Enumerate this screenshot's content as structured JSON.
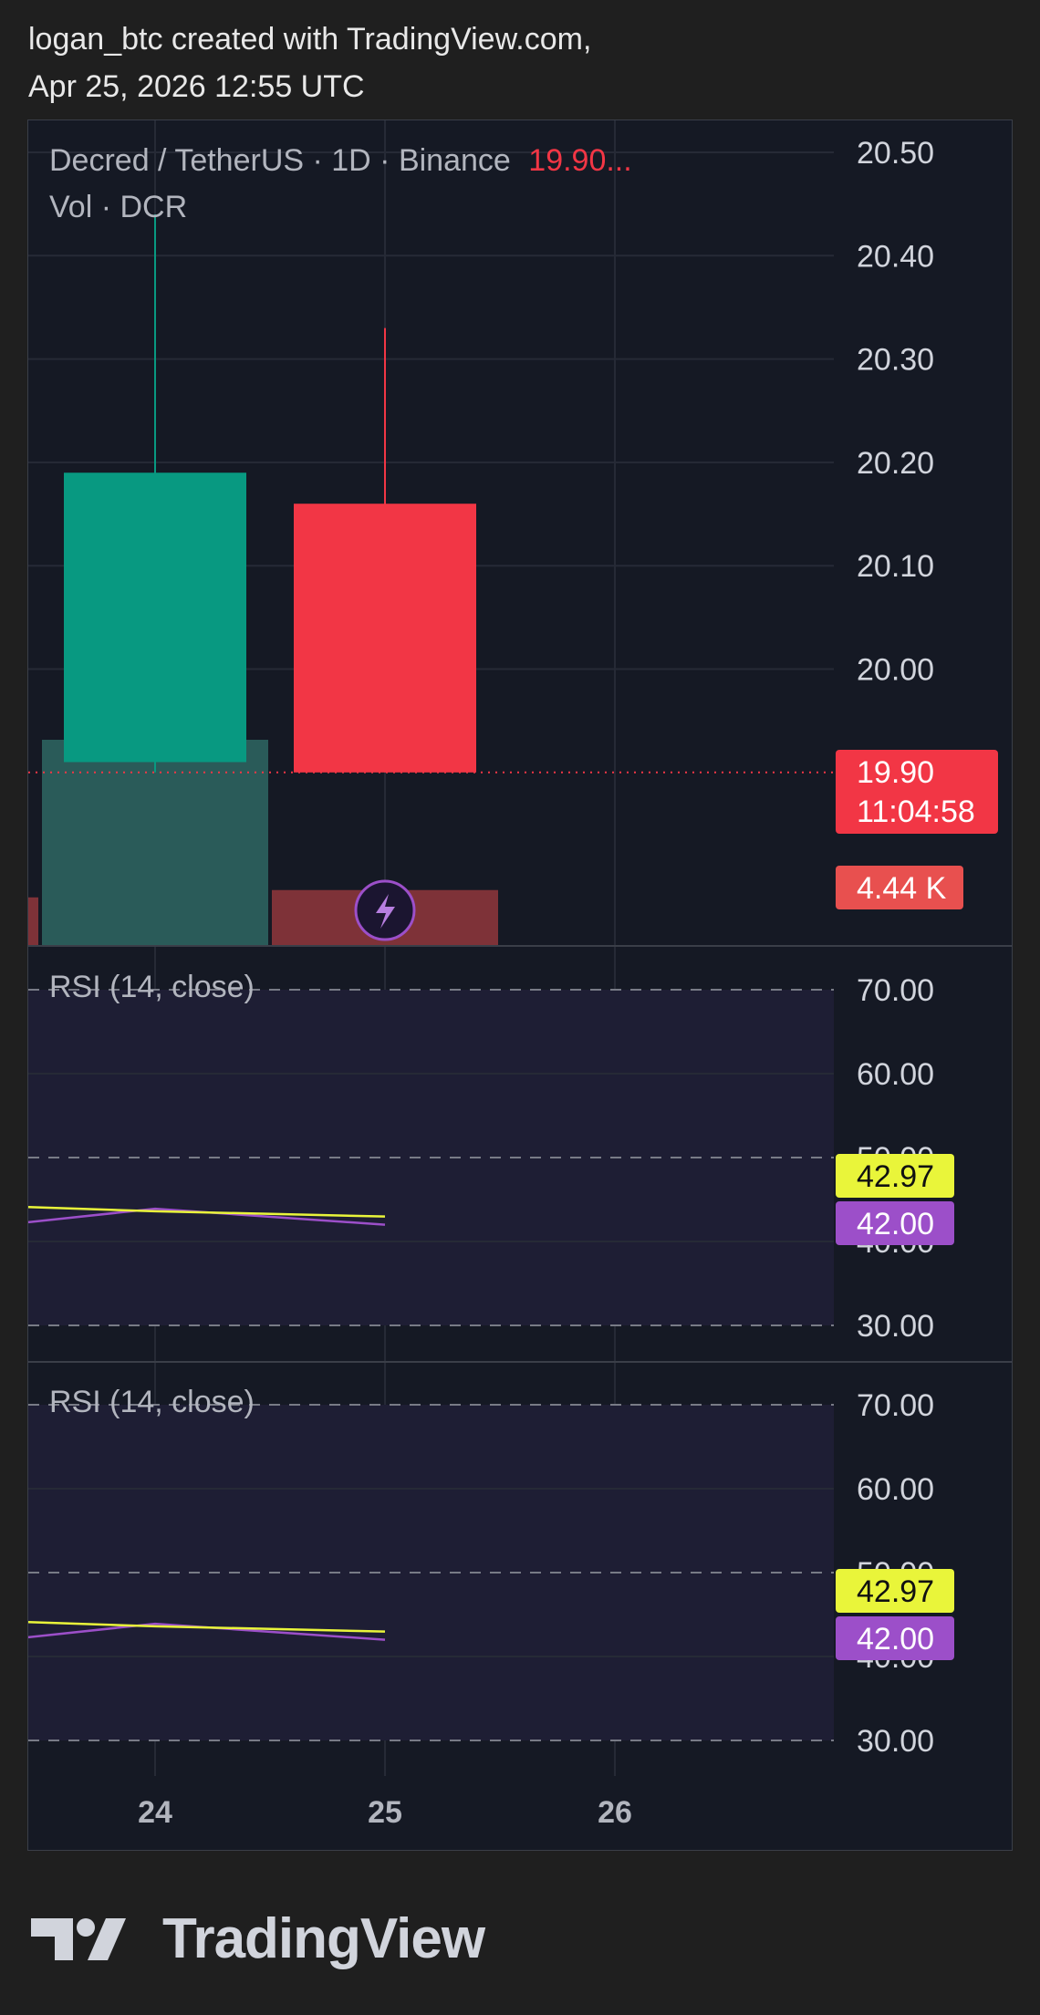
{
  "header": {
    "line1": "logan_btc created with TradingView.com,",
    "line2": "Apr 25, 2026 12:55 UTC"
  },
  "legend": {
    "symbol": "Decred / TetherUS · 1D · Binance",
    "price": "19.90...",
    "volume_label": "Vol · DCR"
  },
  "branding": {
    "logo_text": "TradingView",
    "logo_icon": "tradingview-logo-icon"
  },
  "colors": {
    "up": "#089981",
    "down": "#f23645",
    "rsi_line": "#9c4fc9",
    "rsi_ma": "#e9f53a",
    "background": "#151924",
    "grid": "#262a36"
  },
  "chart_data": [
    {
      "type": "candlestick",
      "title": "Decred / TetherUS · 1D · Binance",
      "x_tick_labels": [
        "24",
        "25",
        "26"
      ],
      "y_tick_labels": [
        "20.50",
        "20.40",
        "20.30",
        "20.20",
        "20.10",
        "20.00"
      ],
      "ylim": [
        19.83,
        20.52
      ],
      "candles": [
        {
          "x": "24",
          "open": 19.91,
          "high": 20.44,
          "low": 19.9,
          "close": 20.19
        },
        {
          "x": "25",
          "open": 20.16,
          "high": 20.33,
          "low": 19.9,
          "close": 19.9
        }
      ],
      "last_price": {
        "value": 19.9,
        "label": "19.90",
        "countdown": "11:04:58"
      },
      "volume": {
        "name": "Vol · DCR",
        "last_label": "4.44 K",
        "bars": [
          {
            "x": "23",
            "value": 1.3,
            "direction": "down"
          },
          {
            "x": "24",
            "value": 5.6,
            "direction": "up"
          },
          {
            "x": "25",
            "value": 1.5,
            "direction": "down"
          }
        ]
      }
    },
    {
      "type": "line",
      "title": "RSI (14, close)",
      "ylim": [
        30,
        70
      ],
      "y_tick_labels": [
        "70.00",
        "60.00",
        "50.00",
        "40.00",
        "30.00"
      ],
      "bands": [
        70,
        50,
        30
      ],
      "x": [
        "23",
        "24",
        "25"
      ],
      "series": [
        {
          "values": [
            42.3,
            43.9,
            42.0
          ],
          "last_label": "42.00",
          "color": "#9c4fc9"
        },
        {
          "values": [
            44.1,
            43.6,
            42.97
          ],
          "last_label": "42.97",
          "color": "#e9f53a"
        }
      ]
    },
    {
      "type": "line",
      "title": "RSI (14, close)",
      "ylim": [
        30,
        70
      ],
      "y_tick_labels": [
        "70.00",
        "60.00",
        "50.00",
        "40.00",
        "30.00"
      ],
      "bands": [
        70,
        50,
        30
      ],
      "x": [
        "23",
        "24",
        "25"
      ],
      "series": [
        {
          "values": [
            42.3,
            43.9,
            42.0
          ],
          "last_label": "42.00",
          "color": "#9c4fc9"
        },
        {
          "values": [
            44.1,
            43.6,
            42.97
          ],
          "last_label": "42.97",
          "color": "#e9f53a"
        }
      ]
    }
  ]
}
